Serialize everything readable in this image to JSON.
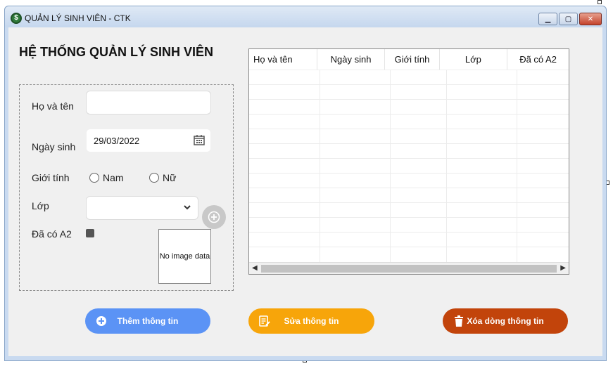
{
  "window": {
    "title": "QUẢN LÝ SINH VIÊN - CTK",
    "minimize_glyph": "▁",
    "maximize_glyph": "▢",
    "close_glyph": "✕"
  },
  "app": {
    "title": "HỆ THỐNG QUẢN LÝ SINH VIÊN"
  },
  "form": {
    "name_label": "Họ và tên",
    "name_value": "",
    "dob_label": "Ngày sinh",
    "dob_value": "29/03/2022",
    "gender_label": "Giới tính",
    "gender_options": [
      "Nam",
      "Nữ"
    ],
    "class_label": "Lớp",
    "class_value": "",
    "a2_label": "Đã có A2",
    "picture_text": "No image data"
  },
  "grid": {
    "columns": [
      "Họ và tên",
      "Ngày sinh",
      "Giới tính",
      "Lớp",
      "Đã có A2"
    ],
    "rows": []
  },
  "buttons": {
    "add": "Thêm thông tin",
    "edit": "Sửa thông tin",
    "delete": "Xóa dòng thông tin"
  },
  "colors": {
    "add": "#5b93f5",
    "edit": "#f7a50a",
    "delete": "#c2440b"
  },
  "icons": {
    "app": "app-logo-icon",
    "calendar": "calendar-icon",
    "dropdown": "chevron-down-icon",
    "add_class": "plus-circle-icon",
    "add": "plus-circle-icon",
    "edit": "edit-document-icon",
    "delete": "trash-icon"
  }
}
